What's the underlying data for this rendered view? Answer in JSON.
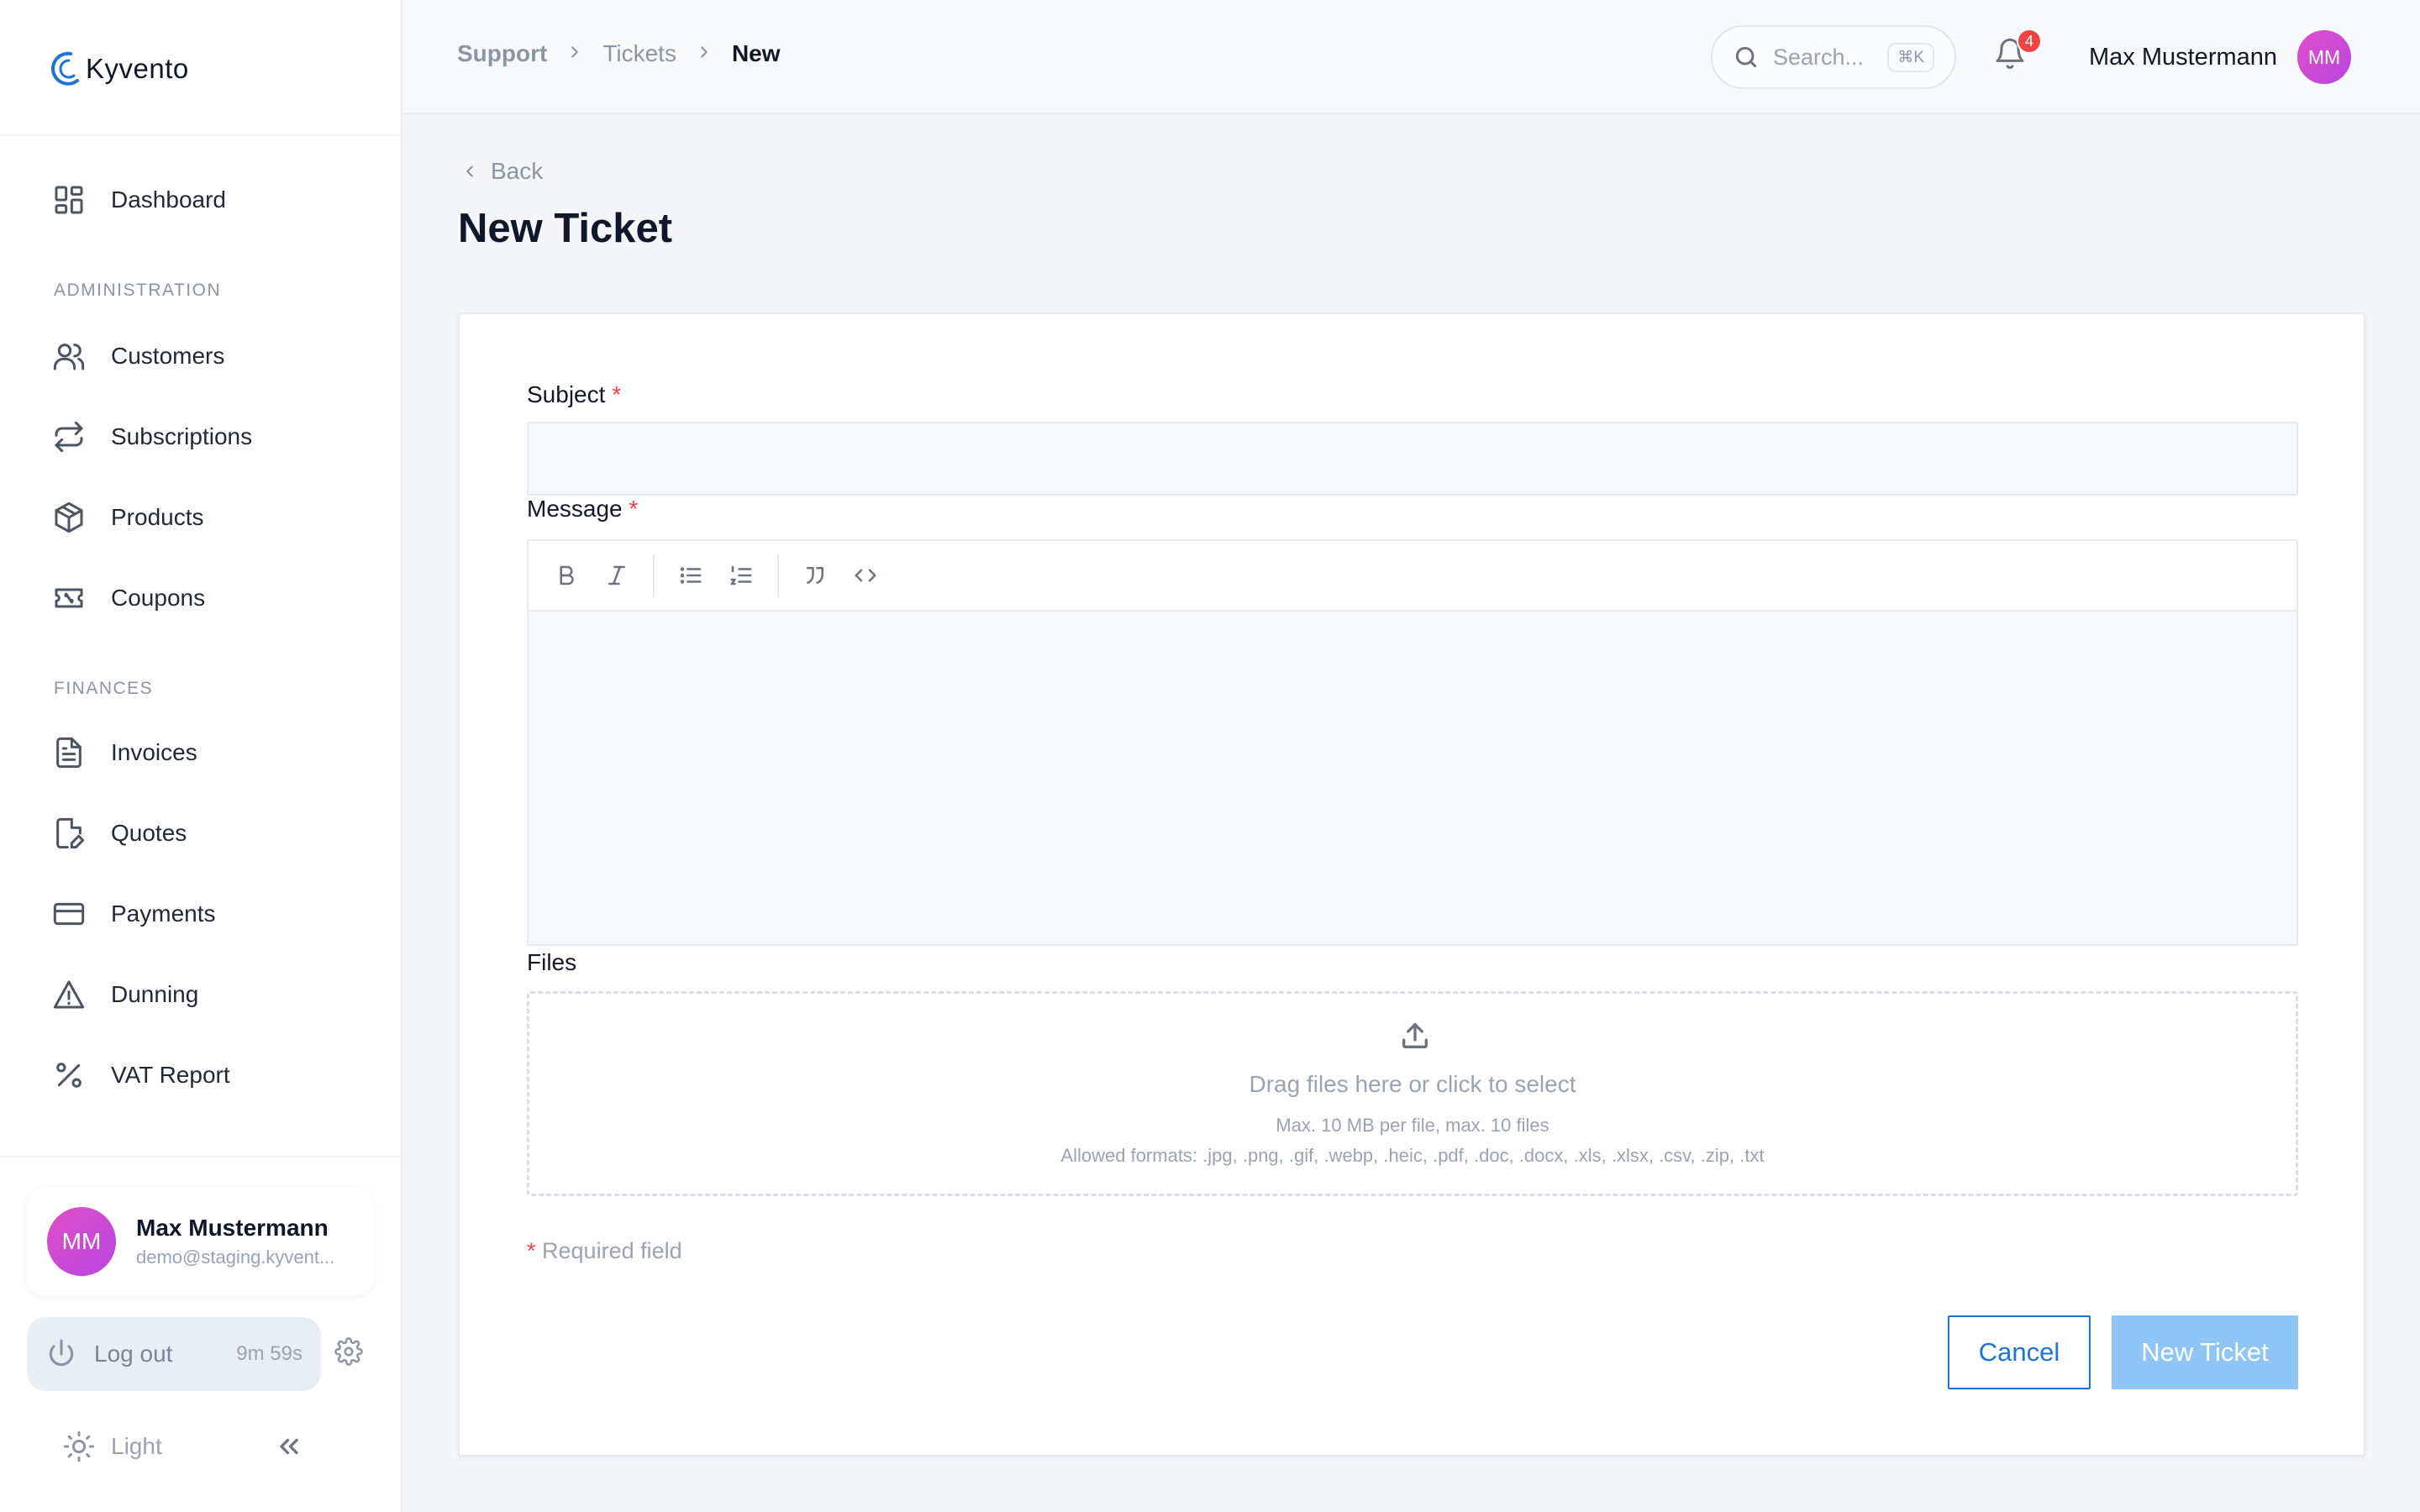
{
  "app": {
    "logo_text": "Kyvento",
    "brand_color": "#1e74d6"
  },
  "sidebar": {
    "dashboard": "Dashboard",
    "sections": [
      {
        "title": "ADMINISTRATION",
        "items": [
          "Customers",
          "Subscriptions",
          "Products",
          "Coupons"
        ]
      },
      {
        "title": "FINANCES",
        "items": [
          "Invoices",
          "Quotes",
          "Payments",
          "Dunning",
          "VAT Report"
        ]
      }
    ],
    "user": {
      "initials": "MM",
      "name": "Max Mustermann",
      "email": "demo@staging.kyvent..."
    },
    "logout": {
      "label": "Log out",
      "timer": "9m 59s"
    },
    "theme": {
      "label": "Light"
    }
  },
  "header": {
    "breadcrumb": [
      "Support",
      "Tickets",
      "New"
    ],
    "search": {
      "placeholder": "Search...",
      "shortcut": "⌘K"
    },
    "notifications_count": "4",
    "user": {
      "name": "Max Mustermann",
      "initials": "MM"
    }
  },
  "page": {
    "back_label": "Back",
    "title": "New Ticket",
    "form": {
      "subject_label": "Subject",
      "subject_value": "",
      "message_label": "Message",
      "required_marker": "*",
      "files_label": "Files",
      "dropzone_main": "Drag files here or click to select",
      "dropzone_limits": "Max. 10 MB per file, max. 10 files",
      "dropzone_formats": "Allowed formats: .jpg, .png, .gif, .webp, .heic, .pdf, .doc, .docx, .xls, .xlsx, .csv, .zip, .txt",
      "required_note": "Required field",
      "cancel_label": "Cancel",
      "submit_label": "New Ticket"
    }
  }
}
